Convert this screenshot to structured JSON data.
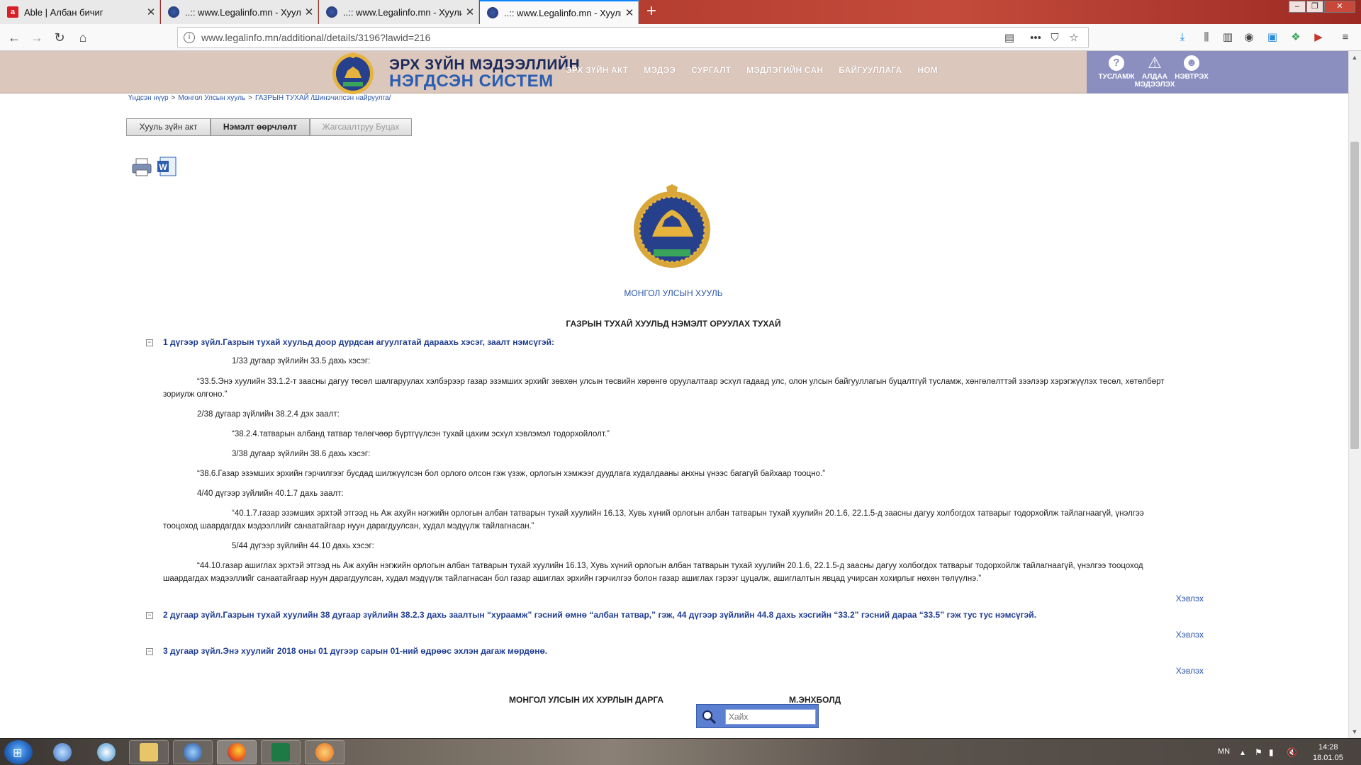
{
  "browser": {
    "tabs": [
      {
        "title": "Able | Албан бичиг",
        "favicon": "able-logo-icon",
        "active": false
      },
      {
        "title": "..:: www.Legalinfo.mn - Хуулий",
        "favicon": "mongolia-emblem-icon",
        "active": false
      },
      {
        "title": "..:: www.Legalinfo.mn - Хуулий",
        "favicon": "mongolia-emblem-icon",
        "active": false
      },
      {
        "title": "..:: www.Legalinfo.mn - Хуулий",
        "favicon": "mongolia-emblem-icon",
        "active": true
      }
    ],
    "url": "www.legalinfo.mn/additional/details/3196?lawid=216"
  },
  "site": {
    "title_line1": "ЭРХ ЗҮЙН МЭДЭЭЛЛИЙН",
    "title_line2": "НЭГДСЭН СИСТЕМ",
    "nav": [
      "ЭРХ ЗҮЙН АКТ",
      "МЭДЭЭ",
      "СУРГАЛТ",
      "МЭДЛЭГИЙН САН",
      "БАЙГУУЛЛАГА",
      "НОМ"
    ],
    "tools": {
      "help": "ТУСЛАМЖ",
      "report_1": "АЛДАА",
      "report_2": "МЭДЭЭЛЭХ",
      "login": "НЭВТРЭХ"
    }
  },
  "breadcrumb": [
    "Үндсэн нүүр",
    "Монгол Улсын хууль",
    "ГАЗРЫН ТУХАЙ /Шинэчилсэн найруулга/"
  ],
  "breadcrumb_sep": ">",
  "buttons": {
    "law_act": "Хууль зүйн акт",
    "amendment": "Нэмэлт өөрчлөлт",
    "back_to_list": "Жагсаалтруу Буцах"
  },
  "law_type": "МОНГОЛ УЛСЫН ХУУЛЬ",
  "law_title": "ГАЗРЫН ТУХАЙ ХУУЛЬД НЭМЭЛТ ОРУУЛАХ ТУХАЙ",
  "articles": [
    {
      "toggle": "−",
      "heading": "1 дүгээр зүйл.Газрын тухай хуульд доор дурдсан агуулгатай дараахь хэсэг, заалт нэмсүгэй:",
      "p1": "1/33 дугаар зүйлийн 33.5 дахь хэсэг:",
      "p2a": "“33.5.Энэ хуулийн 33.1.2-т заасны дагуу төсөл шалгаруулах хэлбэрээр газар эзэмших эрхийг зөвхөн улсын төсвийн хөрөнгө оруулалтаар эсхүл гадаад улс, олон улсын байгууллагын буцалтгүй тусламж, хөнгөлөлттэй зээлээр хэрэгжүүлэх төсөл, хөтөлбөрт",
      "p2b": "зориулж олгоно.”",
      "p3": "2/38 дугаар зүйлийн 38.2.4 дэх заалт:",
      "p4": "“38.2.4.татварын албанд татвар төлөгчөөр бүртгүүлсэн тухай цахим эсхүл хэвлэмэл тодорхойлолт.”",
      "p5": "3/38 дугаар зүйлийн 38.6 дахь хэсэг:",
      "p6": "“38.6.Газар эзэмших эрхийн гэрчилгээг бусдад шилжүүлсэн бол орлого олсон гэж үзэж, орлогын хэмжээг дуудлага худалдааны анхны үнээс багагүй байхаар тооцно.”",
      "p7": "4/40 дүгээр зүйлийн 40.1.7 дахь заалт:",
      "p8a": "“40.1.7.газар эзэмших эрхтэй этгээд нь Аж ахуйн нэгжийн орлогын албан татварын тухай хуулийн 16.13, Хувь хүний орлогын албан татварын тухай хуулийн 20.1.6, 22.1.5-д заасны дагуу холбогдох татварыг тодорхойлж тайлагнаагүй, үнэлгээ",
      "p8b": "тооцоход шаардагдах мэдээллийг санаатайгаар нуун дарагдуулсан, худал мэдүүлж тайлагнасан.”",
      "p9": "5/44 дүгээр зүйлийн 44.10 дахь хэсэг:",
      "p10a": "“44.10.газар ашиглах эрхтэй этгээд нь Аж ахуйн нэгжийн орлогын албан татварын тухай хуулийн 16.13, Хувь хүний орлогын албан татварын тухай хуулийн 20.1.6, 22.1.5-д заасны дагуу холбогдох татварыг тодорхойлж тайлагнаагүй, үнэлгээ тооцоход",
      "p10b": "шаардагдах мэдээллийг санаатайгаар нуун дарагдуулсан, худал мэдүүлж тайлагнасан бол газар ашиглах эрхийн гэрчилгээ болон газар ашиглах гэрээг цуцалж, ашиглалтын явцад учирсан хохирлыг нөхөн төлүүлнэ.”",
      "print": "Хэвлэх"
    },
    {
      "toggle": "−",
      "heading": "2 дугаар зүйл.Газрын тухай хуулийн 38 дугаар зүйлийн 38.2.3 дахь заалтын “хураамж” гэсний өмнө “албан татвар,” гэж, 44 дүгээр зүйлийн 44.8 дахь хэсгийн “33.2” гэсний дараа “33.5” гэж тус тус нэмсүгэй.",
      "print": "Хэвлэх"
    },
    {
      "toggle": "−",
      "heading": "3 дугаар зүйл.Энэ хуулийг 2018 оны 01 дүгээр сарын 01-ний өдрөөс эхлэн дагаж мөрдөнө.",
      "print": "Хэвлэх"
    }
  ],
  "signature": {
    "title": "МОНГОЛ УЛСЫН ИХ ХУРЛЫН ДАРГА",
    "name": "М.ЭНХБОЛД"
  },
  "search": {
    "placeholder": "Хайх"
  },
  "taskbar": {
    "lang": "MN",
    "time": "14:28",
    "date": "18.01.05"
  },
  "colors": {
    "header_bg": "#dcc7bd",
    "tools_bg": "#8b8fc0",
    "link_blue": "#2a55a8",
    "article_blue": "#1f3d91"
  }
}
